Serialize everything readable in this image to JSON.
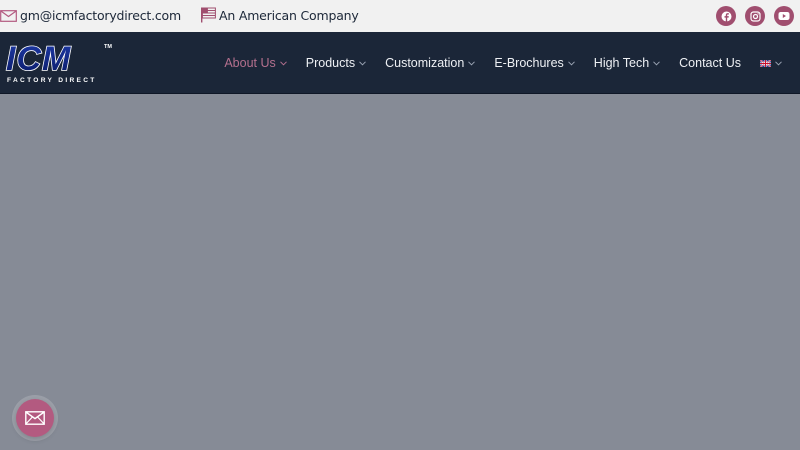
{
  "topbar": {
    "email": "gm@icmfactorydirect.com",
    "email_icon": "envelope-icon",
    "tagline": "An American Company",
    "tagline_icon": "us-flag-icon",
    "social": [
      {
        "name": "facebook-icon"
      },
      {
        "name": "instagram-icon"
      },
      {
        "name": "youtube-icon"
      }
    ]
  },
  "logo": {
    "main": "ICM",
    "sub": "FACTORY DIRECT",
    "mark": "TM"
  },
  "nav": {
    "items": [
      {
        "label": "About Us",
        "active": true,
        "dropdown": true
      },
      {
        "label": "Products",
        "dropdown": true
      },
      {
        "label": "Customization",
        "dropdown": true
      },
      {
        "label": "E-Brochures",
        "dropdown": true
      },
      {
        "label": "High Tech",
        "dropdown": true
      },
      {
        "label": "Contact Us",
        "dropdown": false
      }
    ],
    "language_icon": "uk-flag-icon"
  },
  "floating": {
    "icon": "mail-icon"
  },
  "colors": {
    "topbar_bg": "#f1f1f1",
    "header_bg": "#1b2638",
    "accent": "#a04e6f",
    "hero_bg": "#868b96"
  }
}
